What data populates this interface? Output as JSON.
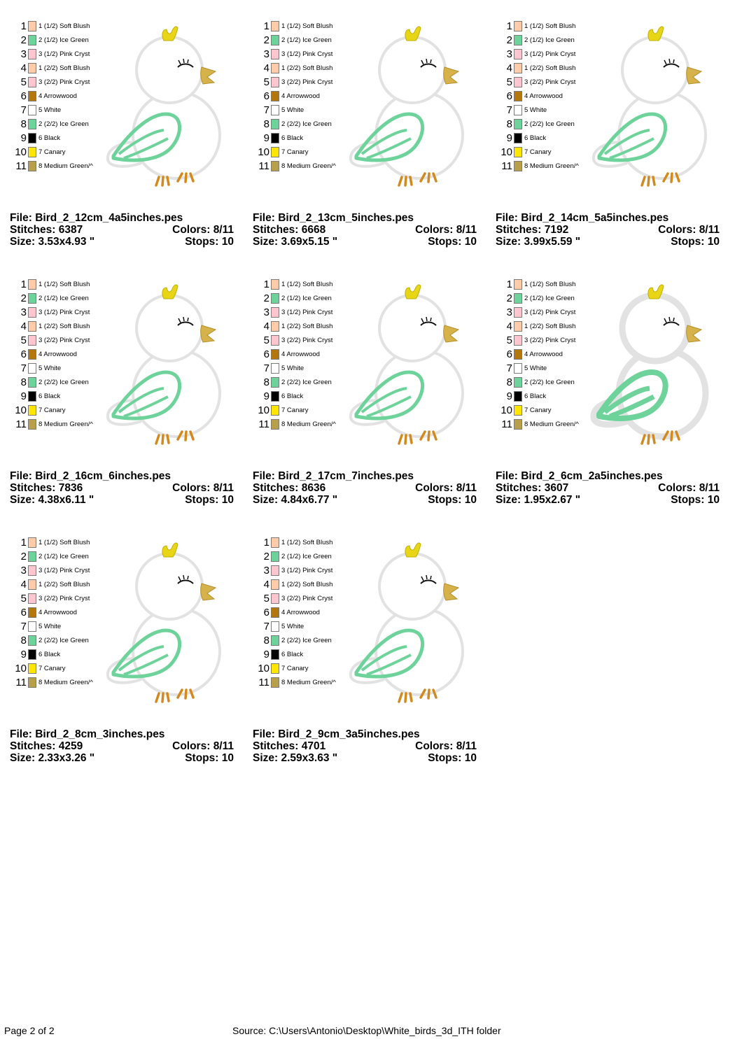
{
  "colors": {
    "soft_blush": "#FFCBA8",
    "ice_green": "#6ED39A",
    "pink_cryst": "#FFC6CF",
    "arrowwood": "#B4770E",
    "white": "#FFFFFF",
    "black": "#000000",
    "canary": "#FFE600",
    "medium_green": "#B8A04A",
    "beak": "#D6B24A",
    "feet": "#D28A1E",
    "crown": "#E8D616",
    "outline": "#E2E2E2"
  },
  "labels": {
    "file": "File:",
    "stitches": "Stitches:",
    "colors": "Colors:",
    "size": "Size:",
    "stops": "Stops:"
  },
  "legend": [
    {
      "num": "1",
      "label": "1 (1/2) Soft Blush",
      "color": "#FFCBA8"
    },
    {
      "num": "2",
      "label": "2 (1/2) Ice Green",
      "color": "#6ED39A"
    },
    {
      "num": "3",
      "label": "3 (1/2) Pink Cryst",
      "color": "#FFC6CF"
    },
    {
      "num": "4",
      "label": "1 (2/2) Soft Blush",
      "color": "#FFCBA8"
    },
    {
      "num": "5",
      "label": "3 (2/2) Pink Cryst",
      "color": "#FFC6CF"
    },
    {
      "num": "6",
      "label": "4 Arrowwood",
      "color": "#B4770E"
    },
    {
      "num": "7",
      "label": "5 White",
      "color": "#FFFFFF"
    },
    {
      "num": "8",
      "label": "2 (2/2) Ice Green",
      "color": "#6ED39A"
    },
    {
      "num": "9",
      "label": "6 Black",
      "color": "#000000"
    },
    {
      "num": "10",
      "label": "7 Canary",
      "color": "#FFE600"
    },
    {
      "num": "11",
      "label": "8 Medium Green/^",
      "color": "#B8A04A"
    }
  ],
  "designs": [
    {
      "file": "Bird_2_12cm_4a5inches.pes",
      "stitches": "6387",
      "colors": "8/11",
      "size": "3.53x4.93 \"",
      "stops": "10"
    },
    {
      "file": "Bird_2_13cm_5inches.pes",
      "stitches": "6668",
      "colors": "8/11",
      "size": "3.69x5.15 \"",
      "stops": "10"
    },
    {
      "file": "Bird_2_14cm_5a5inches.pes",
      "stitches": "7192",
      "colors": "8/11",
      "size": "3.99x5.59 \"",
      "stops": "10"
    },
    {
      "file": "Bird_2_16cm_6inches.pes",
      "stitches": "7836",
      "colors": "8/11",
      "size": "4.38x6.11 \"",
      "stops": "10"
    },
    {
      "file": "Bird_2_17cm_7inches.pes",
      "stitches": "8636",
      "colors": "8/11",
      "size": "4.84x6.77 \"",
      "stops": "10"
    },
    {
      "file": "Bird_2_6cm_2a5inches.pes",
      "stitches": "3607",
      "colors": "8/11",
      "size": "1.95x2.67 \"",
      "stops": "10"
    },
    {
      "file": "Bird_2_8cm_3inches.pes",
      "stitches": "4259",
      "colors": "8/11",
      "size": "2.33x3.26 \"",
      "stops": "10"
    },
    {
      "file": "Bird_2_9cm_3a5inches.pes",
      "stitches": "4701",
      "colors": "8/11",
      "size": "2.59x3.63 \"",
      "stops": "10"
    }
  ],
  "footer": {
    "page": "Page 2 of 2",
    "source": "Source: C:\\Users\\Antonio\\Desktop\\White_birds_3d_ITH folder"
  }
}
